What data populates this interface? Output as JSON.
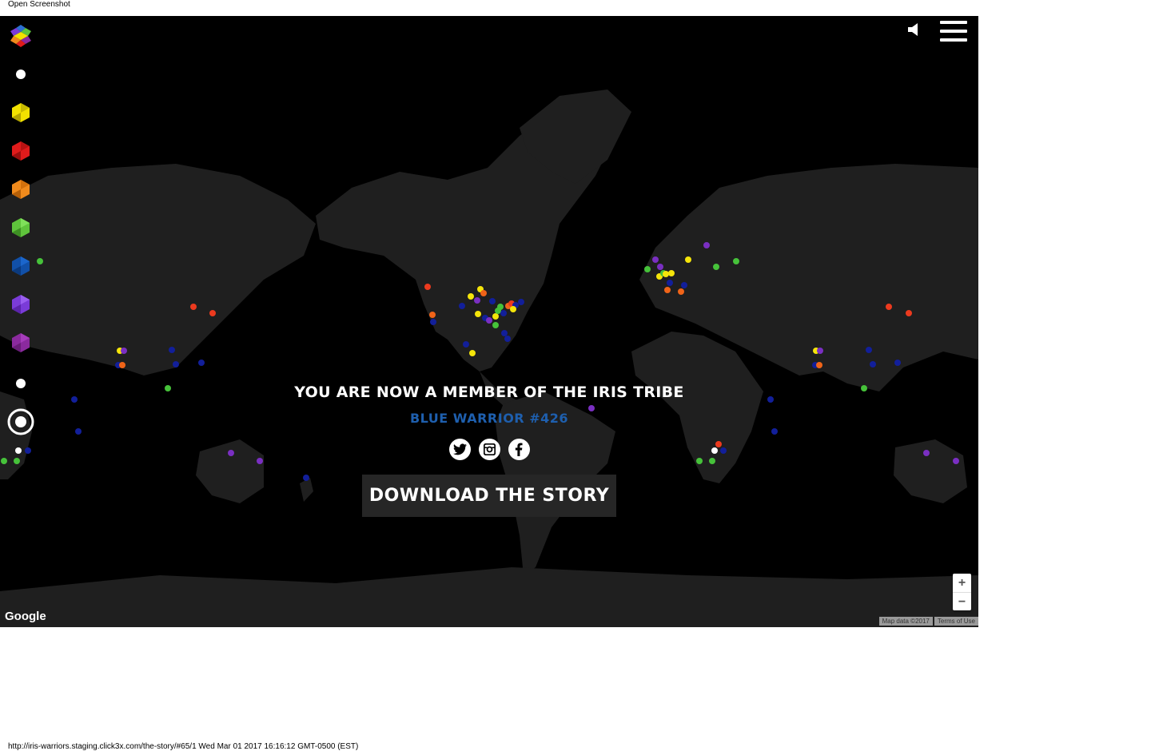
{
  "browser": {
    "top_caption": "Open Screenshot",
    "bottom_caption": "http://iris-warriors.staging.click3x.com/the-story/#65/1 Wed Mar 01 2017 16:16:12 GMT-0500 (EST)"
  },
  "sidebar": {
    "items": [
      {
        "name": "logo",
        "icon": "iris-logo-icon"
      },
      {
        "name": "white",
        "icon": "white-dot-icon",
        "color": "#ffffff"
      },
      {
        "name": "yellow",
        "icon": "yellow-gem-icon",
        "color": "#f2e200"
      },
      {
        "name": "red",
        "icon": "red-gem-icon",
        "color": "#e01b1b"
      },
      {
        "name": "orange",
        "icon": "orange-gem-icon",
        "color": "#f08a1c"
      },
      {
        "name": "green",
        "icon": "green-gem-icon",
        "color": "#5fc43c"
      },
      {
        "name": "blue",
        "icon": "blue-gem-icon",
        "color": "#1150a8"
      },
      {
        "name": "violet",
        "icon": "violet-gem-icon",
        "color": "#7a3bd8"
      },
      {
        "name": "purple",
        "icon": "purple-gem-icon",
        "color": "#8b2a9e"
      },
      {
        "name": "white-bottom",
        "icon": "white-dot-icon",
        "color": "#ffffff"
      },
      {
        "name": "target",
        "icon": "target-icon",
        "color": "#ffffff"
      }
    ]
  },
  "header": {
    "sound_icon": "speaker-icon",
    "menu_icon": "hamburger-menu-icon"
  },
  "main": {
    "title": "YOU ARE NOW A MEMBER OF THE IRIS TRIBE",
    "warrior": "BLUE WARRIOR #426",
    "social": [
      {
        "name": "twitter",
        "icon": "twitter-icon"
      },
      {
        "name": "instagram",
        "icon": "instagram-icon"
      },
      {
        "name": "facebook",
        "icon": "facebook-icon"
      }
    ],
    "download_label": "DOWNLOAD THE STORY"
  },
  "map": {
    "zoom_in": "+",
    "zoom_out": "−",
    "logo": "Google",
    "map_data": "Map data ©2017",
    "terms": "Terms of Use"
  },
  "colors": {
    "accent_blue": "#1e5fae",
    "map_background": "#000000",
    "land": "#1f1f1f",
    "yellow": "#f5e50a",
    "orange": "#f06418",
    "red": "#ec3a1e",
    "green": "#46c23a",
    "blue": "#121f9a",
    "purple": "#7a2fc2",
    "white": "#ffffff"
  }
}
